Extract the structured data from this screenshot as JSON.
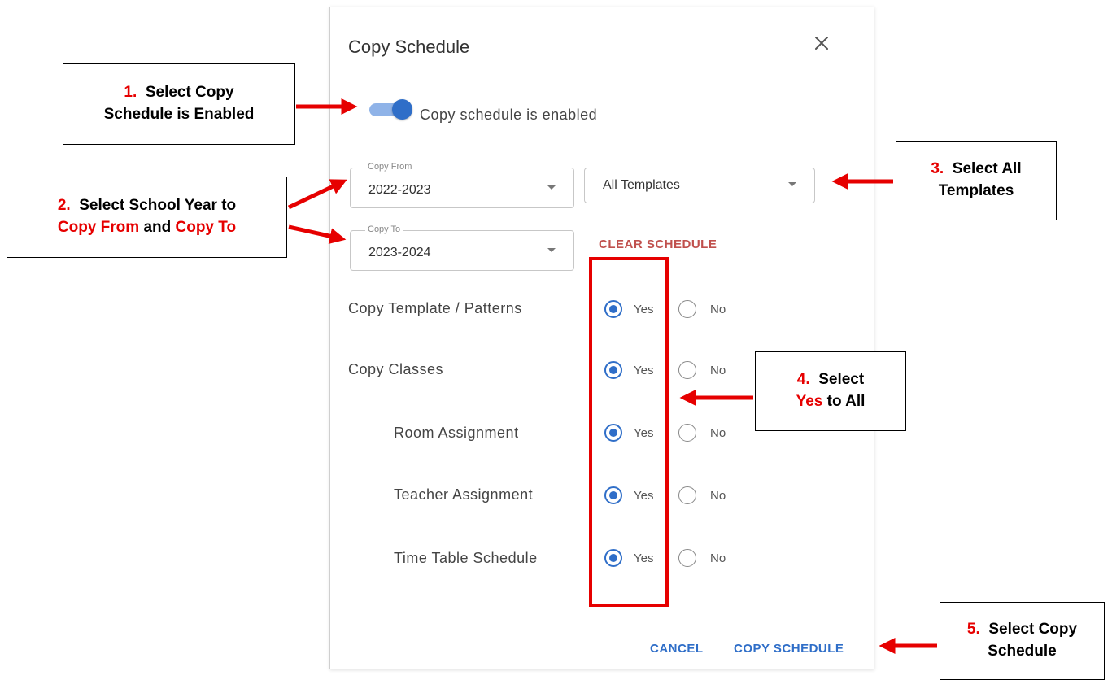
{
  "dialog": {
    "title": "Copy Schedule",
    "close_icon": "close-icon",
    "toggle": {
      "label": "Copy schedule is enabled",
      "on": true
    },
    "copy_from": {
      "legend": "Copy From",
      "value": "2022-2023"
    },
    "templates": {
      "value": "All Templates"
    },
    "copy_to": {
      "legend": "Copy To",
      "value": "2023-2024"
    },
    "clear_schedule_label": "CLEAR SCHEDULE",
    "yes_label": "Yes",
    "no_label": "No",
    "options": [
      {
        "label": "Copy Template / Patterns",
        "selected": "Yes"
      },
      {
        "label": "Copy Classes",
        "selected": "Yes"
      },
      {
        "label": "Room Assignment",
        "selected": "Yes"
      },
      {
        "label": "Teacher Assignment",
        "selected": "Yes"
      },
      {
        "label": "Time Table Schedule",
        "selected": "Yes"
      }
    ],
    "cancel_label": "CANCEL",
    "copy_schedule_label": "COPY SCHEDULE"
  },
  "callouts": {
    "c1": {
      "num": "1.",
      "text_a": "Select Copy",
      "text_b": "Schedule is Enabled"
    },
    "c2": {
      "num": "2.",
      "text_a": "Select School Year to",
      "red_a": "Copy From",
      "mid": "and",
      "red_b": "Copy To"
    },
    "c3": {
      "num": "3.",
      "text_a": "Select All",
      "text_b": "Templates"
    },
    "c4": {
      "num": "4.",
      "text_a": "Select",
      "red_a": "Yes",
      "text_b": "to All"
    },
    "c5": {
      "num": "5.",
      "text_a": "Select Copy",
      "text_b": "Schedule"
    }
  },
  "colors": {
    "accent": "#2f6ec8",
    "danger": "#c0504d",
    "annotation": "#e60000"
  }
}
